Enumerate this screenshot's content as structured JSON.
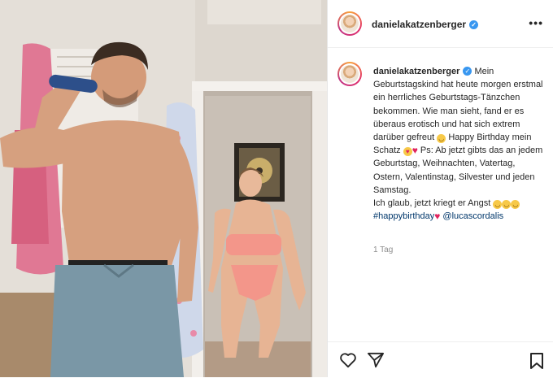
{
  "post": {
    "username": "danielakatzenberger",
    "more_label": "•••",
    "caption_segments": [
      {
        "type": "text",
        "text": "Mein Geburtstagskind hat heute morgen erstmal ein herrliches Geburtstags-Tänzchen bekommen. Wie man sieht, fand er es überaus erotisch und hat sich extrem darüber gefreut "
      },
      {
        "type": "emoji",
        "icon": "laughing-emoji"
      },
      {
        "type": "text",
        "text": " Happy Birthday mein Schatz "
      },
      {
        "type": "emoji",
        "icon": "heart-eyes-emoji"
      },
      {
        "type": "emoji",
        "icon": "red-heart-emoji"
      },
      {
        "type": "text",
        "text": " Ps: Ab jetzt gibts das an jedem Geburtstag, Weihnachten, Vatertag, Ostern, Valentinstag, Silvester und jeden Samstag."
      },
      {
        "type": "break"
      },
      {
        "type": "text",
        "text": "Ich glaub, jetzt kriegt er Angst "
      },
      {
        "type": "emoji",
        "icon": "laughing-emoji"
      },
      {
        "type": "emoji",
        "icon": "laughing-emoji"
      },
      {
        "type": "emoji",
        "icon": "laughing-emoji"
      },
      {
        "type": "break"
      },
      {
        "type": "link",
        "text": "#happybirthday"
      },
      {
        "type": "emoji",
        "icon": "red-heart-emoji"
      },
      {
        "type": "text",
        "text": " "
      },
      {
        "type": "link",
        "text": "@lucascordalis"
      }
    ],
    "timestamp": "1 Tag"
  },
  "colors": {
    "link": "#00376b",
    "verified": "#3897f0",
    "heart": "#e0245e"
  },
  "icons": [
    "verified-badge-icon",
    "more-options-icon",
    "like-heart-icon",
    "share-paper-plane-icon",
    "save-bookmark-icon"
  ]
}
